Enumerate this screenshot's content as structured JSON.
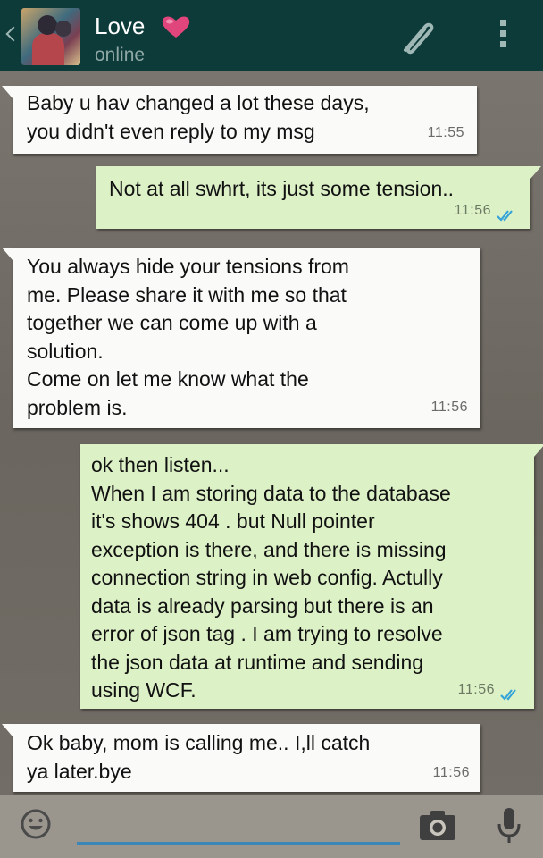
{
  "header": {
    "contact_name": "Love",
    "status": "online"
  },
  "messages": [
    {
      "direction": "incoming",
      "text": "Baby u hav changed a lot these days,\nyou didn't even reply to my msg",
      "time": "11:55"
    },
    {
      "direction": "outgoing",
      "text": "Not at all swhrt, its just some tension..",
      "time": "11:56",
      "status": "read"
    },
    {
      "direction": "incoming",
      "text": "You always hide your tensions from\nme. Please share it with me so that\ntogether we can come up with a\nsolution.\nCome on let me know what the\nproblem is.",
      "time": "11:56"
    },
    {
      "direction": "outgoing",
      "text": "ok then listen...\nWhen I am storing data to the database\nit's shows 404 . but Null pointer\nexception is there, and there is missing\nconnection string in web config. Actully\ndata is already parsing but there is an\nerror of json tag . I am trying to resolve\nthe json data at runtime and sending\nusing WCF.",
      "time": "11:56",
      "status": "read"
    },
    {
      "direction": "incoming",
      "text": "Ok baby, mom is calling me.. I,ll catch\nya later.bye",
      "time": "11:56"
    }
  ],
  "input": {
    "value": "",
    "placeholder": ""
  },
  "icons": {
    "back": "back-arrow-icon",
    "heart": "heart-icon",
    "attach": "paperclip-icon",
    "menu": "overflow-menu-icon",
    "emoji": "emoji-icon",
    "camera": "camera-icon",
    "mic": "microphone-icon",
    "read_receipt": "double-check-icon"
  },
  "colors": {
    "header_bg": "#0d3b3a",
    "incoming_bubble": "#fafaf8",
    "outgoing_bubble": "#ddf1c7",
    "heart": "#e0457b",
    "read_ticks": "#34a4d8",
    "input_underline": "#3d87b6"
  }
}
